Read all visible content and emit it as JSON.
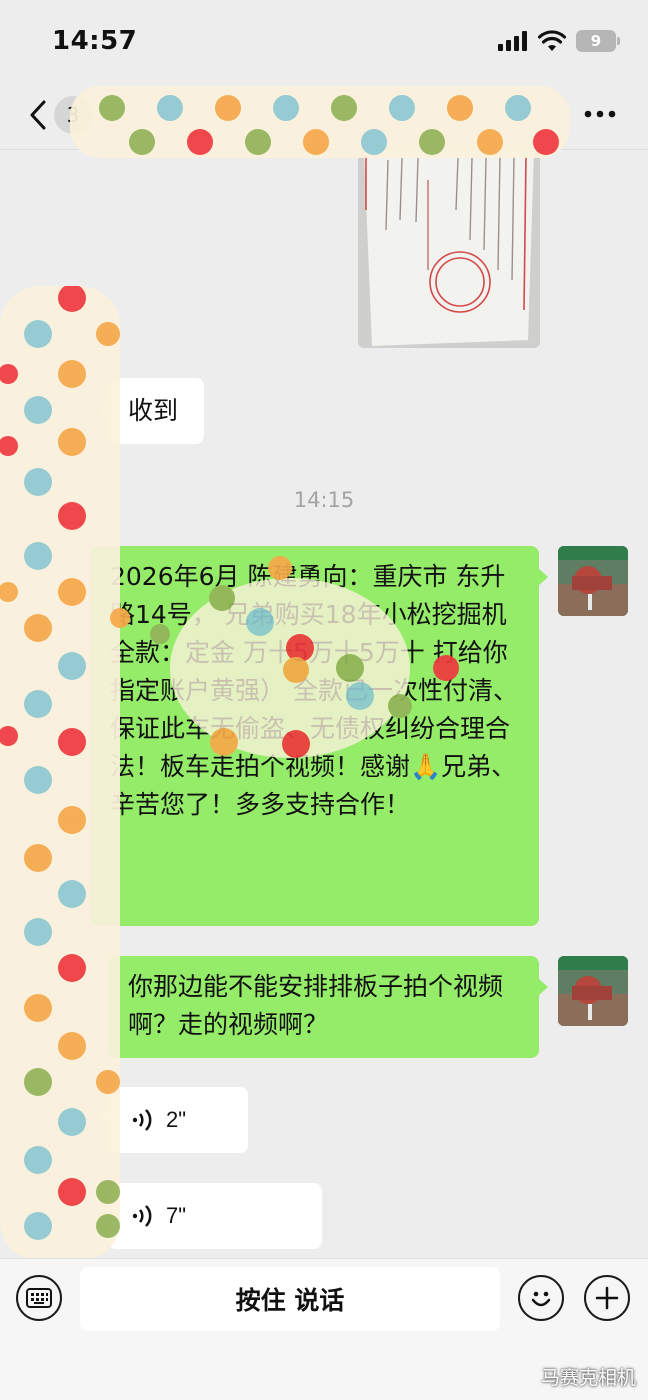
{
  "status_bar": {
    "time": "14:57",
    "battery": "9"
  },
  "nav": {
    "unread_count": "3"
  },
  "messages": {
    "received_text": "收到",
    "timestamp": "14:15",
    "sent_long": "2026年6月 陈建勇向：重庆市 东升路14号， 兄弟购买18年小松挖掘机全款：定金 万十5万十5万十 打给你指定账户黄强） 全款已一次性付清、保证此车无偷盗、无债权纠纷合理合法！板车走拍个视频！感谢🙏兄弟、辛苦您了！多多支持合作！",
    "sent_short": "你那边能不能安排排板子拍个视频啊？走的视频啊？",
    "voice_1": "2\"",
    "voice_2": "7\""
  },
  "input_bar": {
    "hold_to_talk": "按住 说话"
  },
  "watermark": "马赛克相机",
  "colors": {
    "background": "#ededed",
    "sent_bubble": "#95ec69",
    "received_bubble": "#ffffff",
    "dot_colors": [
      "#8fc9d2",
      "#f6a94a",
      "#f03a3e",
      "#93b458"
    ]
  },
  "icons": [
    "back-icon",
    "more-icon",
    "signal-icon",
    "wifi-icon",
    "battery-icon",
    "voice-wave-icon",
    "keyboard-icon",
    "emoji-icon",
    "plus-icon"
  ]
}
